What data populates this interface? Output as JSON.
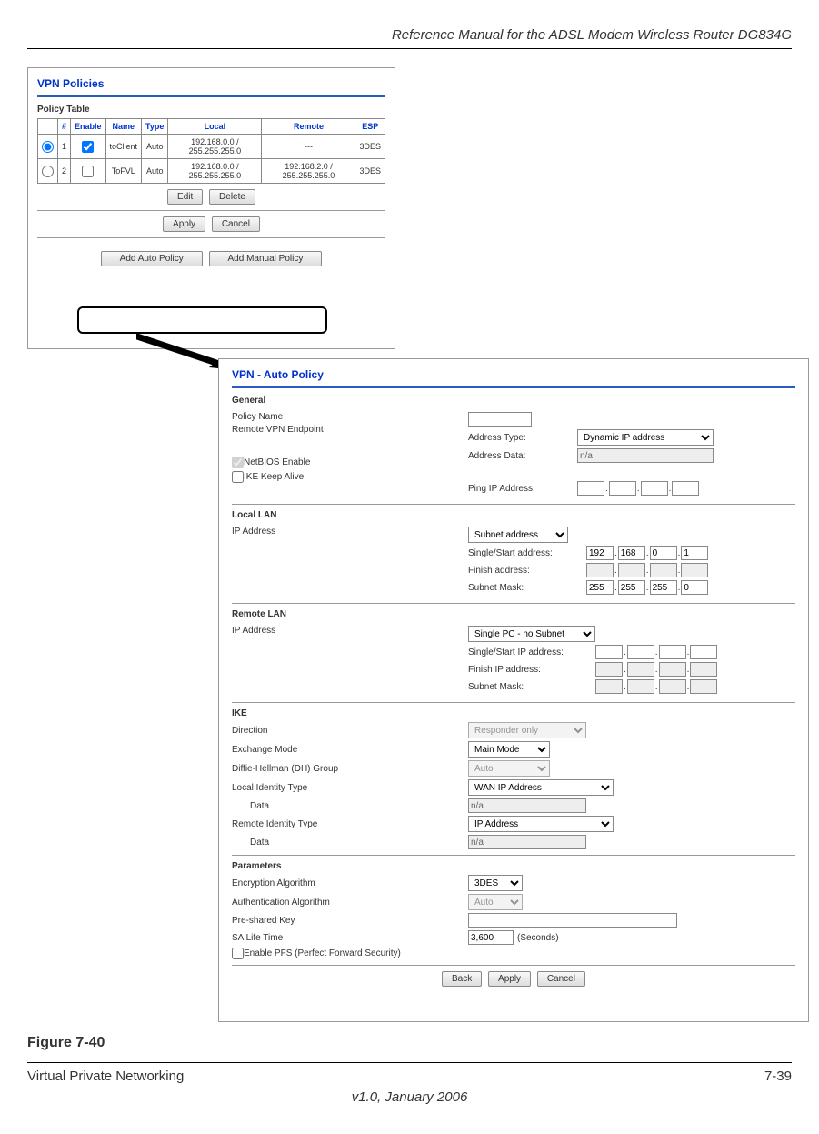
{
  "header_title": "Reference Manual for the ADSL Modem Wireless Router DG834G",
  "figure_caption": "Figure 7-40",
  "footer": {
    "left": "Virtual Private Networking",
    "right": "7-39",
    "version": "v1.0, January 2006"
  },
  "panel1": {
    "title": "VPN Policies",
    "table_label": "Policy Table",
    "headers": [
      "",
      "#",
      "Enable",
      "Name",
      "Type",
      "Local",
      "Remote",
      "ESP"
    ],
    "rows": [
      {
        "sel": true,
        "num": "1",
        "enable": true,
        "name": "toClient",
        "type": "Auto",
        "local": "192.168.0.0 / 255.255.255.0",
        "remote": "---",
        "esp": "3DES"
      },
      {
        "sel": false,
        "num": "2",
        "enable": false,
        "name": "ToFVL",
        "type": "Auto",
        "local": "192.168.0.0 / 255.255.255.0",
        "remote": "192.168.2.0 / 255.255.255.0",
        "esp": "3DES"
      }
    ],
    "buttons": {
      "edit": "Edit",
      "delete": "Delete",
      "apply": "Apply",
      "cancel": "Cancel",
      "add_auto": "Add Auto Policy",
      "add_manual": "Add Manual Policy"
    }
  },
  "panel2": {
    "title": "VPN - Auto Policy",
    "general": {
      "head": "General",
      "policy_name_lbl": "Policy Name",
      "remote_ep_lbl": "Remote VPN Endpoint",
      "addr_type_lbl": "Address Type:",
      "addr_type_val": "Dynamic IP address",
      "addr_data_lbl": "Address Data:",
      "addr_data_val": "n/a",
      "netbios_lbl": "NetBIOS Enable",
      "ike_keep_lbl": "IKE Keep Alive",
      "ping_lbl": "Ping IP Address:"
    },
    "local_lan": {
      "head": "Local LAN",
      "ip_lbl": "IP Address",
      "select_val": "Subnet address",
      "single_lbl": "Single/Start address:",
      "single_ip": [
        "192",
        "168",
        "0",
        "1"
      ],
      "finish_lbl": "Finish address:",
      "mask_lbl": "Subnet Mask:",
      "mask_ip": [
        "255",
        "255",
        "255",
        "0"
      ]
    },
    "remote_lan": {
      "head": "Remote LAN",
      "ip_lbl": "IP Address",
      "select_val": "Single PC - no Subnet",
      "single_lbl": "Single/Start IP address:",
      "finish_lbl": "Finish IP address:",
      "mask_lbl": "Subnet Mask:"
    },
    "ike": {
      "head": "IKE",
      "direction_lbl": "Direction",
      "direction_val": "Responder only",
      "exchange_lbl": "Exchange Mode",
      "exchange_val": "Main Mode",
      "dh_lbl": "Diffie-Hellman (DH) Group",
      "dh_val": "Auto",
      "local_id_lbl": "Local Identity Type",
      "local_id_val": "WAN IP Address",
      "local_data_lbl": "Data",
      "local_data_val": "n/a",
      "remote_id_lbl": "Remote Identity Type",
      "remote_id_val": "IP Address",
      "remote_data_lbl": "Data",
      "remote_data_val": "n/a"
    },
    "params": {
      "head": "Parameters",
      "enc_lbl": "Encryption Algorithm",
      "enc_val": "3DES",
      "auth_lbl": "Authentication Algorithm",
      "auth_val": "Auto",
      "psk_lbl": "Pre-shared Key",
      "sa_lbl": "SA Life Time",
      "sa_val": "3,600",
      "sa_unit": "(Seconds)",
      "pfs_lbl": "Enable PFS (Perfect Forward Security)"
    },
    "buttons": {
      "back": "Back",
      "apply": "Apply",
      "cancel": "Cancel"
    }
  }
}
